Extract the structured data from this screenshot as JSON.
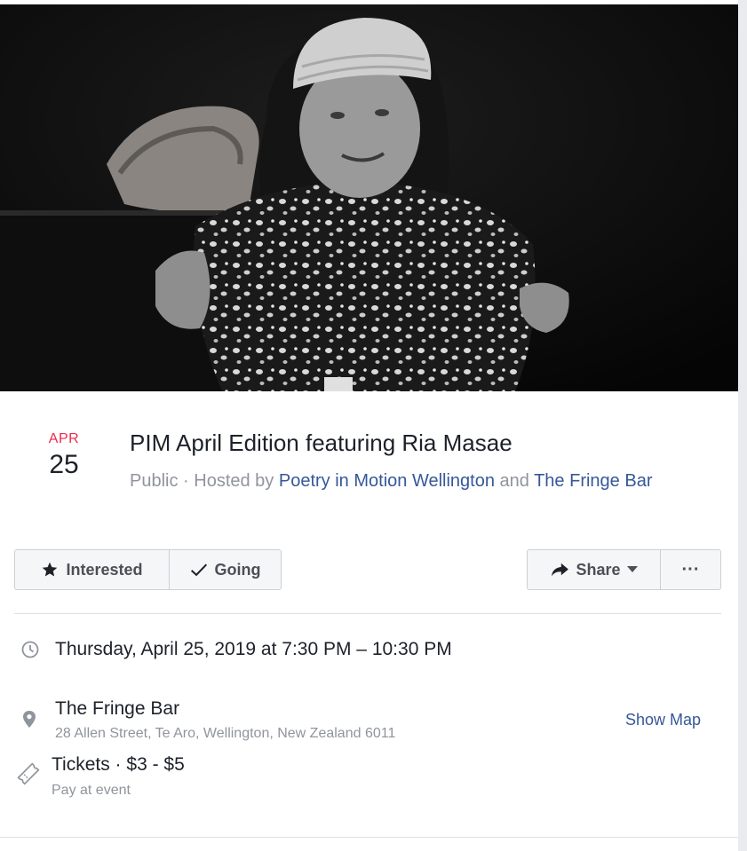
{
  "event": {
    "date_month": "APR",
    "date_day": "25",
    "title": "PIM April Edition featuring Ria Masae",
    "visibility": "Public",
    "hosted_prefix": " · Hosted by ",
    "host1": "Poetry in Motion Wellington",
    "host_join": " and ",
    "host2": "The Fringe Bar"
  },
  "actions": {
    "interested_label": "Interested",
    "going_label": "Going",
    "share_label": "Share",
    "more_label": "···"
  },
  "details": {
    "time": "Thursday, April 25, 2019 at 7:30 PM – 10:30 PM",
    "venue_name": "The Fringe Bar",
    "venue_address": "28 Allen Street, Te Aro, Wellington, New Zealand 6011",
    "show_map_label": "Show Map",
    "tickets_label": "Tickets · $3 - $5",
    "tickets_sub": "Pay at event"
  },
  "colors": {
    "accent_red": "#f02849",
    "link_blue": "#365899",
    "muted_gray": "#90949c"
  },
  "icons": {
    "time": "clock-icon",
    "location": "map-pin-icon",
    "tickets": "ticket-icon",
    "interested": "star-icon",
    "going": "checkmark-icon",
    "share": "share-arrow-icon",
    "dropdown": "caret-down-icon"
  }
}
